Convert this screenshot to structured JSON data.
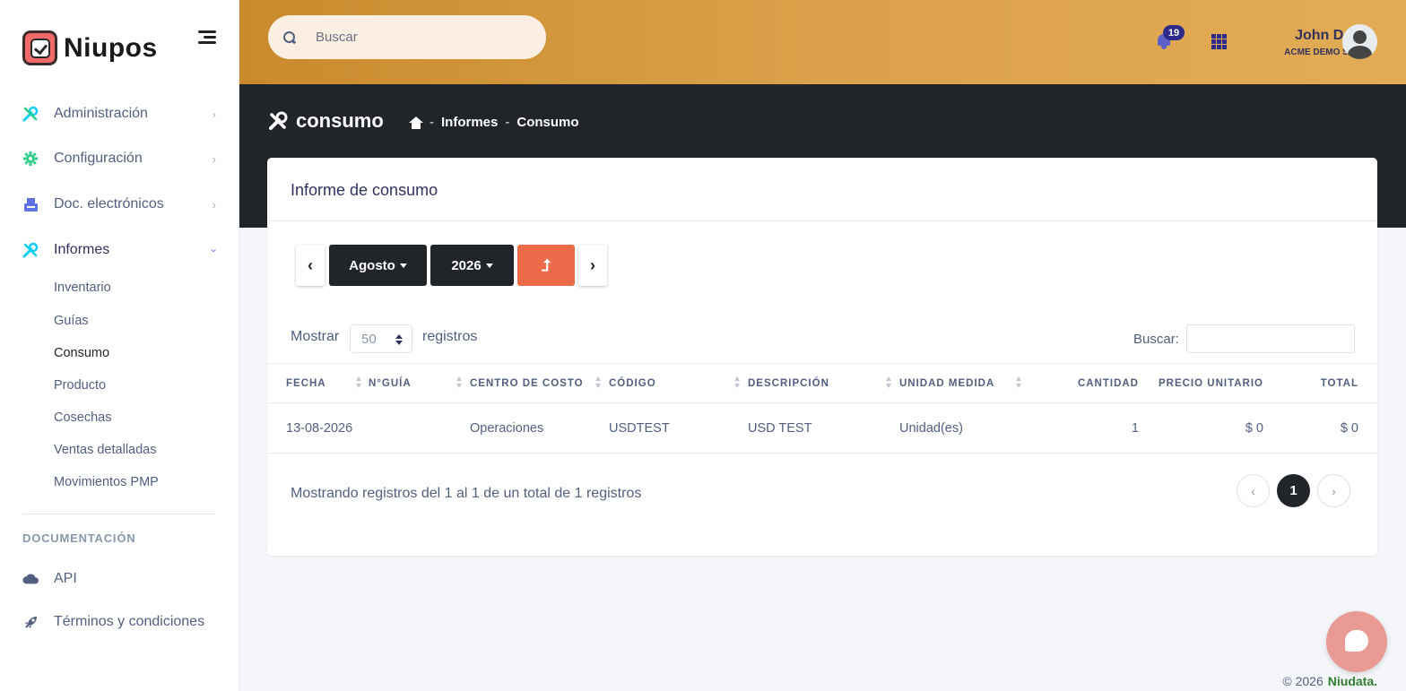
{
  "brand": {
    "name": "Niupos"
  },
  "sidebar": {
    "items": [
      {
        "label": "Administración",
        "icon": "tools-icon",
        "color": "#2dce89"
      },
      {
        "label": "Configuración",
        "icon": "gear-icon",
        "color": "#2dce89"
      },
      {
        "label": "Doc. electrónicos",
        "icon": "receipt-icon",
        "color": "#5e72e4"
      },
      {
        "label": "Informes",
        "icon": "tools-icon",
        "color": "#11cdef"
      }
    ],
    "sub_items": [
      "Inventario",
      "Guías",
      "Consumo",
      "Producto",
      "Cosechas",
      "Ventas detalladas",
      "Movimientos PMP"
    ],
    "active_sub": "Consumo",
    "section_title": "DOCUMENTACIÓN",
    "doc_items": [
      {
        "label": "API",
        "icon": "cloud-icon"
      },
      {
        "label": "Términos y condiciones",
        "icon": "rocket-icon"
      }
    ]
  },
  "topbar": {
    "search_placeholder": "Buscar",
    "notifications_count": "19",
    "user_name": "John Doe",
    "user_company": "ACME DEMO SPA"
  },
  "page": {
    "title": "consumo",
    "breadcrumb": [
      "Informes",
      "Consumo"
    ]
  },
  "report": {
    "card_title": "Informe de consumo",
    "month": "Agosto",
    "year": "2026",
    "export_glyph": "⮥",
    "show_label": "Mostrar",
    "page_size": "50",
    "records_label": "registros",
    "filter_label": "Buscar:",
    "columns": [
      "FECHA",
      "N°GUÍA",
      "CENTRO DE COSTO",
      "CÓDIGO",
      "DESCRIPCIÓN",
      "UNIDAD MEDIDA",
      "CANTIDAD",
      "PRECIO UNITARIO",
      "TOTAL"
    ],
    "rows": [
      [
        "13-08-2026",
        "",
        "Operaciones",
        "USDTEST",
        "USD TEST",
        "Unidad(es)",
        "1",
        "$ 0",
        "$ 0"
      ]
    ],
    "info": "Mostrando registros del 1 al 1 de un total de 1 registros",
    "current_page": "1"
  },
  "footer": {
    "copyright": "© 2026",
    "company": "Niudata."
  },
  "colors": {
    "accent_orange": "#ec6a4a",
    "topbar": "#dba14a",
    "dark": "#212529"
  }
}
